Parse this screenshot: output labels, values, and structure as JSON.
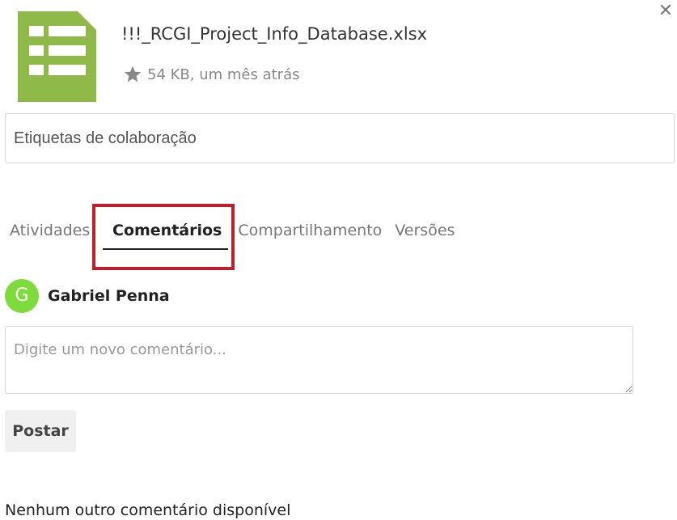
{
  "file": {
    "name": "!!!_RCGI_Project_Info_Database.xlsx",
    "meta": "54 KB, um mês atrás",
    "icon": "spreadsheet-icon",
    "icon_color": "#8fba4a"
  },
  "close_icon": "close-icon",
  "tags": {
    "placeholder": "Etiquetas de colaboração"
  },
  "tabs": [
    {
      "label": "Atividades"
    },
    {
      "label": "Comentários",
      "active": true
    },
    {
      "label": "Compartilhamento"
    },
    {
      "label": "Versões"
    }
  ],
  "highlight_color": "#c0202e",
  "user": {
    "initial": "G",
    "name": "Gabriel Penna",
    "avatar_color": "#7ddb3c"
  },
  "comment": {
    "placeholder": "Digite um novo comentário..."
  },
  "post_label": "Postar",
  "empty_message": "Nenhum outro comentário disponível"
}
